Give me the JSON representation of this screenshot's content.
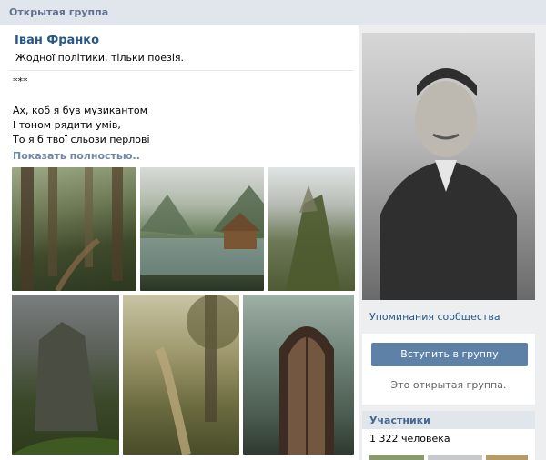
{
  "header": {
    "title": "Открытая группа"
  },
  "group": {
    "name": "Іван Франко",
    "status": "Жодної політики, тільки поезія."
  },
  "post": {
    "lines": [
      "***",
      "",
      "Ах, коб я був музикантом",
      "І тоном рядити умів,",
      "То я б твої сльози перлові"
    ],
    "show_more": "Показать полностью.."
  },
  "sidebar": {
    "mentions": "Упоминания сообщества",
    "join_button": "Вступить в группу",
    "open_group_text": "Это открытая группа.",
    "members_title": "Участники",
    "members_count": "1 322 человека"
  }
}
